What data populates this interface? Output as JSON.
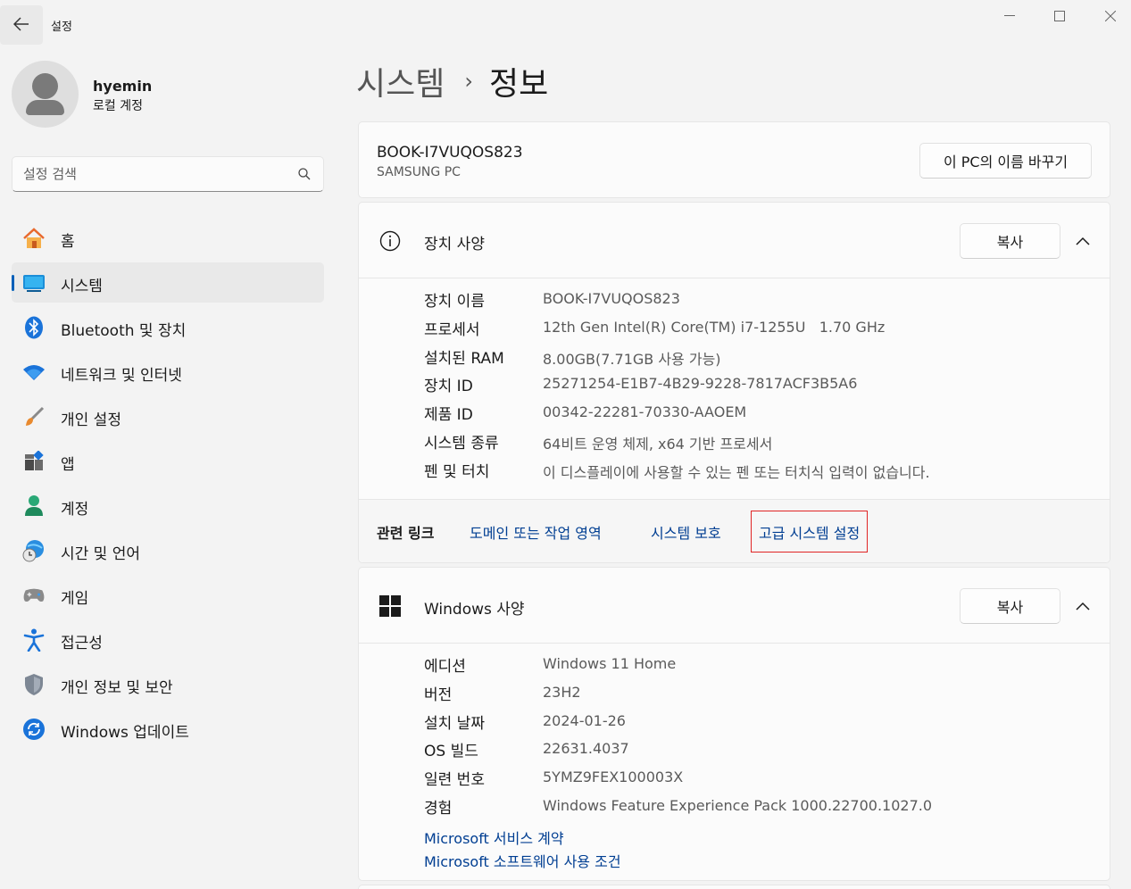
{
  "window": {
    "title": "설정",
    "back_icon": "arrow-left-icon",
    "controls": {
      "minimize": "—",
      "maximize": "☐",
      "close": "✕"
    }
  },
  "profile": {
    "name": "hyemin",
    "account_type": "로컬 계정"
  },
  "search": {
    "placeholder": "설정 검색",
    "value": ""
  },
  "sidebar": {
    "items": [
      {
        "label": "홈",
        "icon": "home-icon",
        "active": false
      },
      {
        "label": "시스템",
        "icon": "system-monitor-icon",
        "active": true
      },
      {
        "label": "Bluetooth 및 장치",
        "icon": "bluetooth-icon",
        "active": false
      },
      {
        "label": "네트워크 및 인터넷",
        "icon": "wifi-icon",
        "active": false
      },
      {
        "label": "개인 설정",
        "icon": "paintbrush-icon",
        "active": false
      },
      {
        "label": "앱",
        "icon": "apps-icon",
        "active": false
      },
      {
        "label": "계정",
        "icon": "account-icon",
        "active": false
      },
      {
        "label": "시간 및 언어",
        "icon": "globe-clock-icon",
        "active": false
      },
      {
        "label": "게임",
        "icon": "gamepad-icon",
        "active": false
      },
      {
        "label": "접근성",
        "icon": "accessibility-icon",
        "active": false
      },
      {
        "label": "개인 정보 및 보안",
        "icon": "shield-icon",
        "active": false
      },
      {
        "label": "Windows 업데이트",
        "icon": "update-icon",
        "active": false
      }
    ]
  },
  "breadcrumb": {
    "parent": "시스템",
    "separator": "›",
    "current": "정보"
  },
  "pc": {
    "name": "BOOK-I7VUQOS823",
    "model": "SAMSUNG PC",
    "rename_label": "이 PC의 이름 바꾸기"
  },
  "device_specs": {
    "title": "장치 사양",
    "copy_label": "복사",
    "rows": [
      {
        "label": "장치 이름",
        "value": "BOOK-I7VUQOS823"
      },
      {
        "label": "프로세서",
        "value": "12th Gen Intel(R) Core(TM) i7-1255U   1.70 GHz"
      },
      {
        "label": "설치된 RAM",
        "value": "8.00GB(7.71GB 사용 가능)"
      },
      {
        "label": "장치 ID",
        "value": "25271254-E1B7-4B29-9228-7817ACF3B5A6"
      },
      {
        "label": "제품 ID",
        "value": "00342-22281-70330-AAOEM"
      },
      {
        "label": "시스템 종류",
        "value": "64비트 운영 체제, x64 기반 프로세서"
      },
      {
        "label": "펜 및 터치",
        "value": "이 디스플레이에 사용할 수 있는 펜 또는 터치식 입력이 없습니다."
      }
    ]
  },
  "related_links": {
    "label": "관련 링크",
    "links": [
      "도메인 또는 작업 영역",
      "시스템 보호",
      "고급 시스템 설정"
    ]
  },
  "windows_specs": {
    "title": "Windows 사양",
    "copy_label": "복사",
    "rows": [
      {
        "label": "에디션",
        "value": "Windows 11 Home"
      },
      {
        "label": "버전",
        "value": "23H2"
      },
      {
        "label": "설치 날짜",
        "value": "2024-01-26"
      },
      {
        "label": "OS 빌드",
        "value": "22631.4037"
      },
      {
        "label": "일련 번호",
        "value": "5YMZ9FEX100003X"
      },
      {
        "label": "경험",
        "value": "Windows Feature Experience Pack 1000.22700.1027.0"
      }
    ],
    "links": [
      "Microsoft 서비스 계약",
      "Microsoft 소프트웨어 사용 조건"
    ]
  },
  "colors": {
    "accent": "#005fb8",
    "link": "#003e92",
    "highlight_box": "#e02525"
  }
}
